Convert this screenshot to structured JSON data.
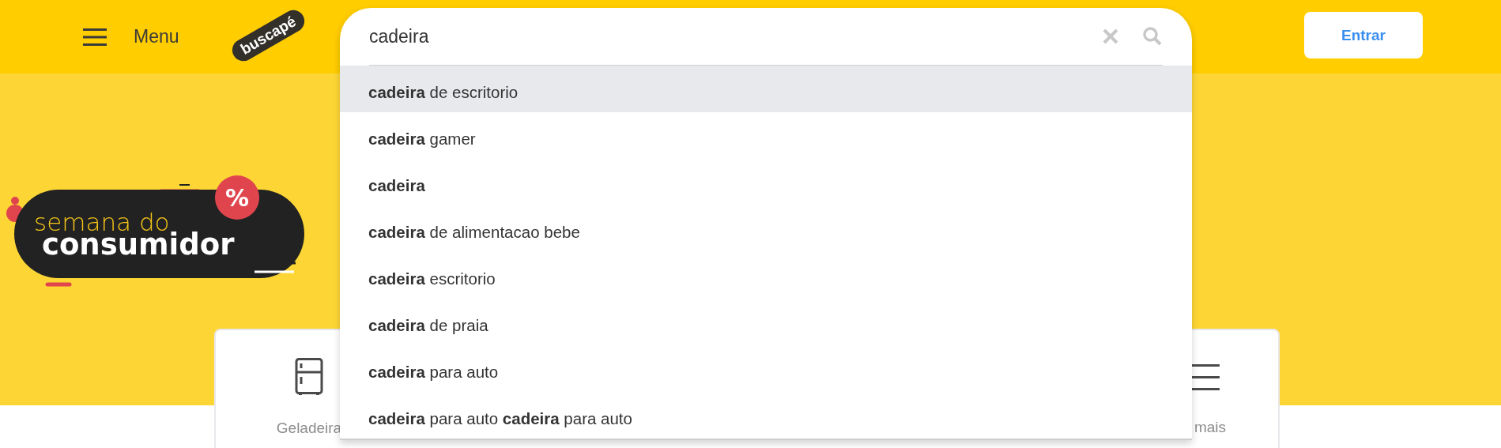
{
  "header": {
    "menu_label": "Menu",
    "logo": "buscapé",
    "login_button": "Entrar"
  },
  "search": {
    "value": "cadeira",
    "suggestions": [
      {
        "text": "**cadeira** de escritorio",
        "selected": true
      },
      {
        "text": "**cadeira** gamer",
        "selected": false
      },
      {
        "text": "**cadeira**",
        "selected": false
      },
      {
        "text": "**cadeira** de alimentacao bebe",
        "selected": false
      },
      {
        "text": "**cadeira** escritorio",
        "selected": false
      },
      {
        "text": "**cadeira** de praia",
        "selected": false
      },
      {
        "text": "**cadeira** para auto",
        "selected": false
      },
      {
        "text": "**cadeira** para auto **cadeira** para auto",
        "selected": false
      }
    ]
  },
  "banner": {
    "line_1": "semana do",
    "line_2": "consumidor",
    "badge": "%"
  },
  "categories": [
    {
      "label": "Geladeira",
      "kind": "fridge"
    },
    {
      "label": "mais",
      "kind": "more"
    }
  ]
}
